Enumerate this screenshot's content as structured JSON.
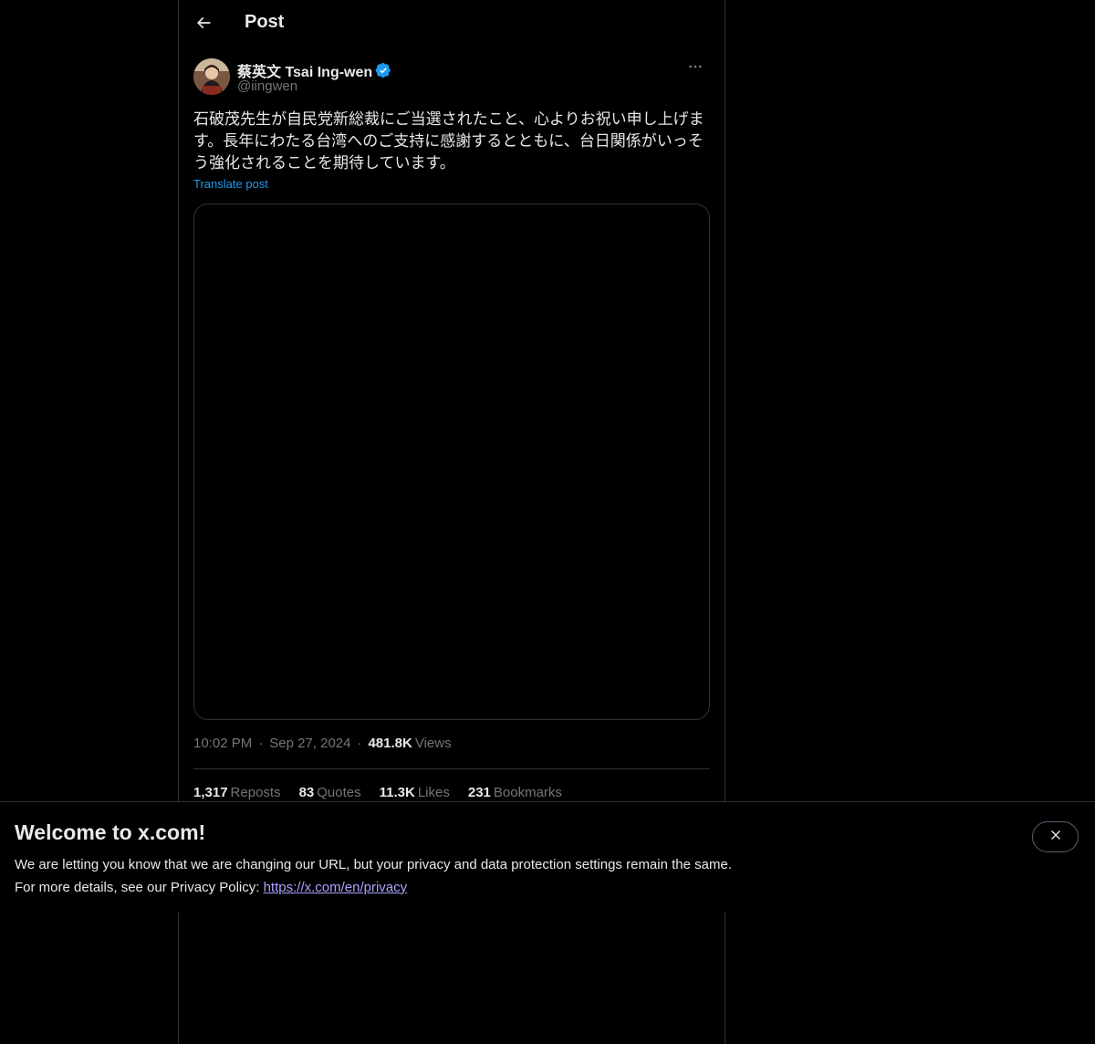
{
  "header": {
    "title": "Post",
    "back_icon": "arrow-left-icon"
  },
  "author": {
    "name": "蔡英文 Tsai Ing-wen",
    "handle": "@iingwen",
    "verified": true,
    "verified_color": "#1d9bf0"
  },
  "post": {
    "text": "石破茂先生が自民党新総裁にご当選されたこと、心よりお祝い申し上げます。長年にわたる台湾へのご支持に感謝するとともに、台日関係がいっそう強化されることを期待しています。",
    "translate_label": "Translate post",
    "time": "10:02 PM",
    "date": "Sep 27, 2024",
    "views_count": "481.8K",
    "views_label": "Views"
  },
  "stats": {
    "reposts_count": "1,317",
    "reposts_label": "Reposts",
    "quotes_count": "83",
    "quotes_label": "Quotes",
    "likes_count": "11.3K",
    "likes_label": "Likes",
    "bookmarks_count": "231",
    "bookmarks_label": "Bookmarks"
  },
  "banner": {
    "title": "Welcome to x.com!",
    "line1": "We are letting you know that we are changing our URL, but your privacy and data protection settings remain the same.",
    "line2_prefix": "For more details, see our Privacy Policy: ",
    "link": "https://x.com/en/privacy",
    "close_icon": "close-icon"
  },
  "colors": {
    "background": "#000000",
    "text": "#e7e9ea",
    "muted": "#71767b",
    "accent": "#1d9bf0",
    "link": "#a9a3ff"
  }
}
